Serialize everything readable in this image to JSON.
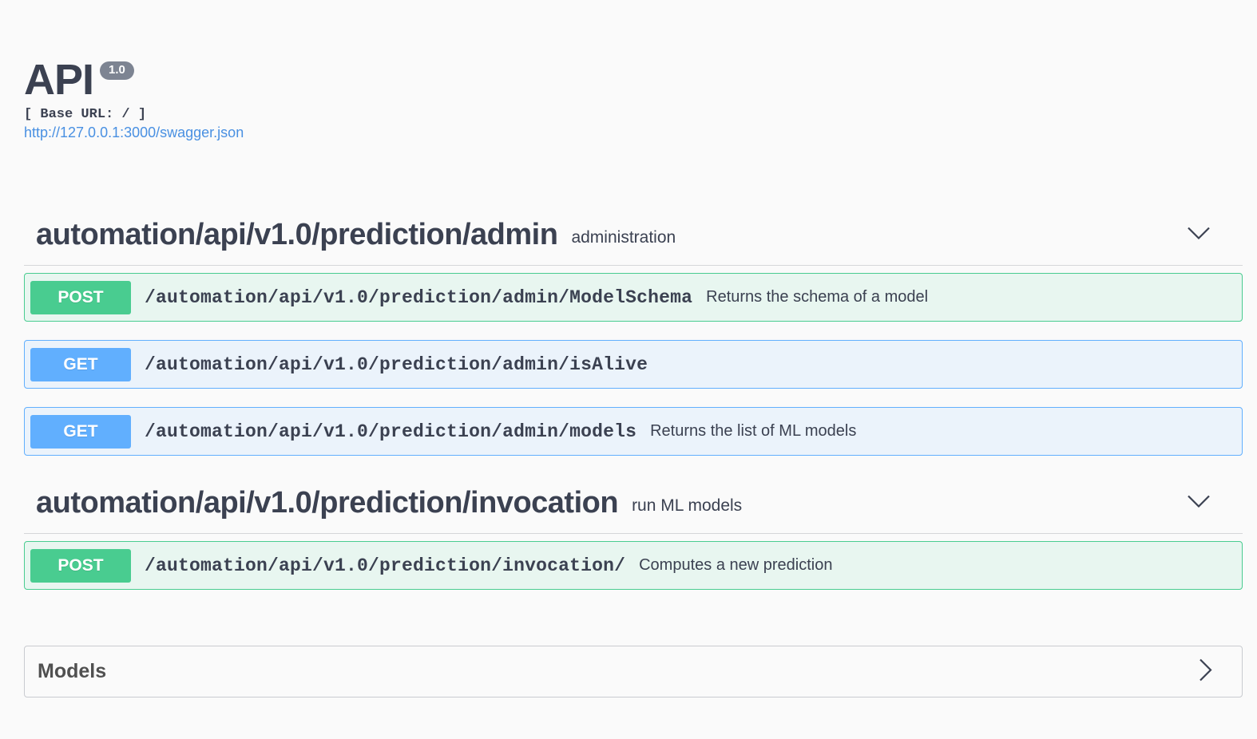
{
  "info": {
    "title": "API",
    "version": "1.0",
    "base_url": "[ Base URL: / ]",
    "spec_link": "http://127.0.0.1:3000/swagger.json"
  },
  "tags": [
    {
      "name": "automation/api/v1.0/prediction/admin",
      "description": "administration",
      "toggle_icon": "chevron-down-icon",
      "operations": [
        {
          "method": "POST",
          "path": "/automation/api/v1.0/prediction/admin/ModelSchema",
          "summary": "Returns the schema of a model"
        },
        {
          "method": "GET",
          "path": "/automation/api/v1.0/prediction/admin/isAlive",
          "summary": ""
        },
        {
          "method": "GET",
          "path": "/automation/api/v1.0/prediction/admin/models",
          "summary": "Returns the list of ML models"
        }
      ]
    },
    {
      "name": "automation/api/v1.0/prediction/invocation",
      "description": "run ML models",
      "toggle_icon": "chevron-down-icon",
      "operations": [
        {
          "method": "POST",
          "path": "/automation/api/v1.0/prediction/invocation/",
          "summary": "Computes a new prediction"
        }
      ]
    }
  ],
  "models": {
    "title": "Models",
    "toggle_icon": "chevron-right-icon"
  },
  "colors": {
    "post": "#49cc90",
    "get": "#61affe",
    "link": "#4990e2",
    "text": "#3b4151"
  }
}
